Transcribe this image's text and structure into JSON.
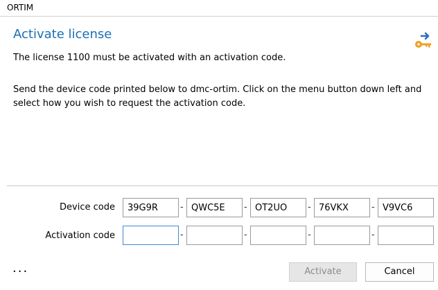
{
  "window": {
    "title": "ORTIM"
  },
  "header": {
    "title": "Activate license",
    "description": "The license 1100 must be activated with an activation code.",
    "icon": "key-arrow-icon"
  },
  "instructions": "Send the device code printed below to dmc-ortim. Click on the menu button down left and select how you wish to request the activation code.",
  "device_code": {
    "label": "Device code",
    "segments": [
      "39G9R",
      "QWC5E",
      "OT2UO",
      "76VKX",
      "V9VC6"
    ],
    "separator": "-"
  },
  "activation_code": {
    "label": "Activation code",
    "segments": [
      "",
      "",
      "",
      "",
      ""
    ],
    "separator": "-"
  },
  "footer": {
    "menu_label": "...",
    "activate_label": "Activate",
    "cancel_label": "Cancel"
  },
  "colors": {
    "accent": "#1a6fb4",
    "icon_key": "#f0a020",
    "icon_arrow": "#2f6fb6"
  }
}
